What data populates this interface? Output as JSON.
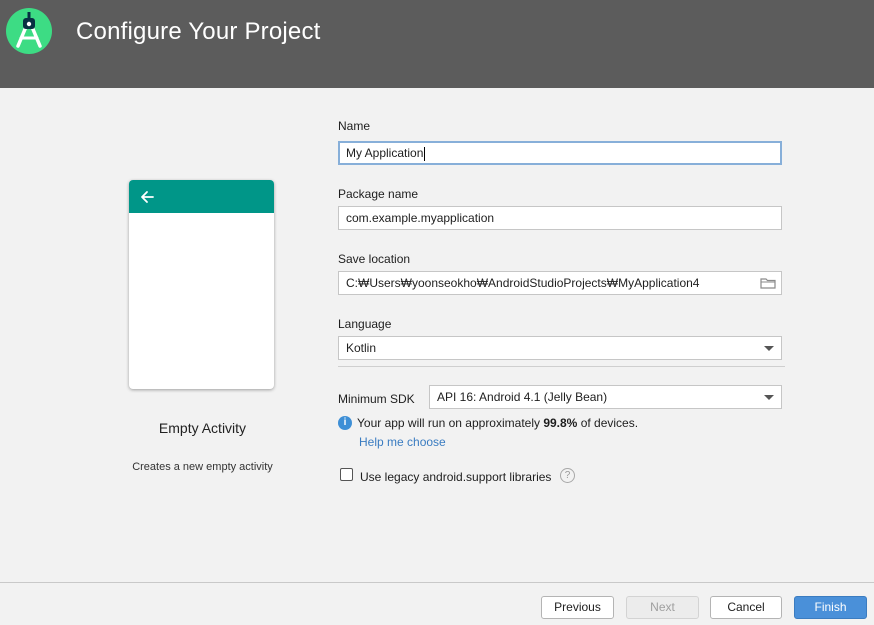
{
  "header": {
    "title": "Configure Your Project",
    "logo_icon": "android-studio-logo-icon"
  },
  "preview": {
    "activity_name": "Empty Activity",
    "activity_desc": "Creates a new empty activity",
    "appbar_color": "#009688"
  },
  "form": {
    "name": {
      "label": "Name",
      "value": "My Application"
    },
    "package": {
      "label": "Package name",
      "value": "com.example.myapplication"
    },
    "save_location": {
      "label": "Save location",
      "value": "C:₩Users₩yoonseokho₩AndroidStudioProjects₩MyApplication4"
    },
    "language": {
      "label": "Language",
      "value": "Kotlin"
    },
    "min_sdk": {
      "label": "Minimum SDK",
      "value": "API 16: Android 4.1 (Jelly Bean)"
    },
    "info": {
      "prefix": "Your app will run on approximately ",
      "percent": "99.8%",
      "suffix": " of devices."
    },
    "help_link": "Help me choose",
    "legacy_checkbox": {
      "label": "Use legacy android.support libraries",
      "checked": false
    }
  },
  "footer": {
    "previous": "Previous",
    "next": "Next",
    "cancel": "Cancel",
    "finish": "Finish"
  },
  "colors": {
    "header_bg": "#5c5c5c",
    "accent": "#4a90d9",
    "link": "#3a7cc1"
  }
}
